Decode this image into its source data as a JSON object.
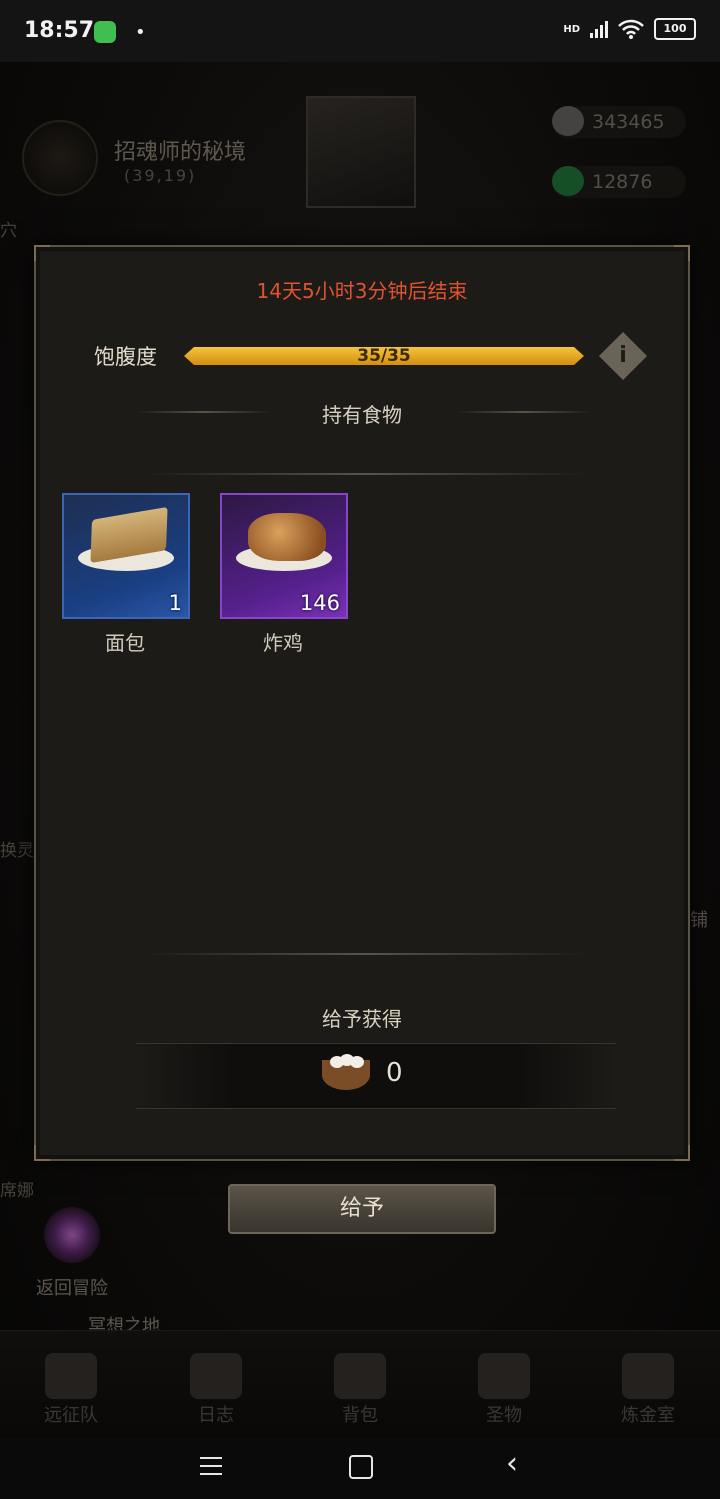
{
  "status_bar": {
    "time": "18:57",
    "hd": "HD",
    "battery": "100"
  },
  "background": {
    "area_title": "招魂师的秘境",
    "coords": "(39,19)",
    "resources": [
      {
        "icon": "stone-currency-icon",
        "value": "343465"
      },
      {
        "icon": "emerald-currency-icon",
        "value": "12876"
      }
    ],
    "left_labels": [
      "穴",
      "换灵之地",
      "席娜"
    ],
    "return_label": "返回冒险",
    "meditation_label": "冥想之地",
    "shop_label": "商铺"
  },
  "bottom_nav": [
    {
      "label": "远征队",
      "icon": "helmet-icon"
    },
    {
      "label": "日志",
      "icon": "journal-icon"
    },
    {
      "label": "背包",
      "icon": "backpack-icon"
    },
    {
      "label": "圣物",
      "icon": "relic-icon"
    },
    {
      "label": "炼金室",
      "icon": "alchemy-icon"
    }
  ],
  "dialog": {
    "timer": "14天5小时3分钟后结束",
    "satiety_label": "饱腹度",
    "satiety_value": "35/35",
    "satiety_fraction": 1.0,
    "info_glyph": "i",
    "section_food": "持有食物",
    "items": [
      {
        "name": "面包",
        "count": "1",
        "rarity": "blue",
        "icon": "bread-icon"
      },
      {
        "name": "炸鸡",
        "count": "146",
        "rarity": "purple",
        "icon": "fried-chicken-icon"
      }
    ],
    "section_reward": "给予获得",
    "reward_value": "0",
    "reward_icon": "eggs-icon"
  },
  "give_button": "给予",
  "colors": {
    "timer": "#e0532e",
    "satiety_bar": "#e6a91f",
    "rarity_blue": "#2c56a8",
    "rarity_purple": "#7a32b8"
  }
}
